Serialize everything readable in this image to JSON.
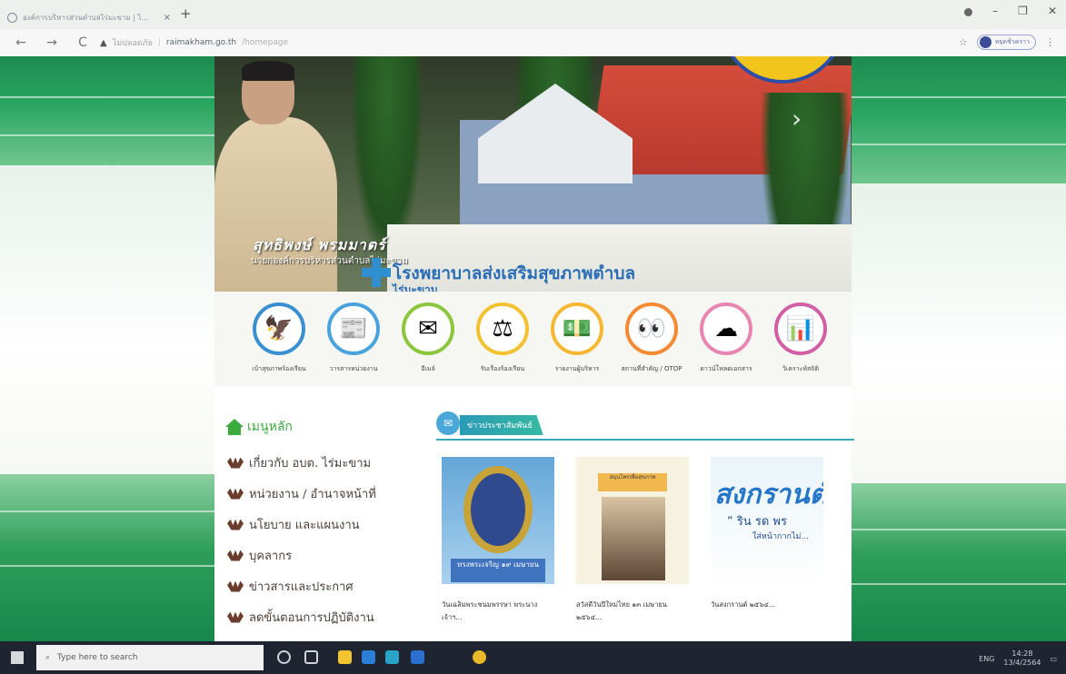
{
  "browser": {
    "tab_title": "องค์การบริหารส่วนตำบลไร่มะขาม | ไ...",
    "tab_close": "×",
    "new_tab": "+",
    "back": "←",
    "forward": "→",
    "reload": "C",
    "security": "ไม่ปลอดภัย",
    "url_host": "raimakham.go.th",
    "url_path": "/homepage",
    "profile_label": "หยุดชั่วคราว",
    "minimize": "–",
    "restore": "❐",
    "close": "✕"
  },
  "hero": {
    "person_name": "สุทธิพงษ์ พรมมาตร์",
    "person_position": "นายกองค์การบริหารส่วนตำบลไร่มะขาม",
    "sign_line1": "โรงพยาบาลส่งเสริมสุขภาพตำบล",
    "sign_line2": "ไร่มะขาม",
    "next_arrow": "›"
  },
  "quick_links": [
    {
      "label": "เบ้าสุขภาพร้องเรียน",
      "icon": "garuda-icon",
      "color": "#3a8fd0",
      "glyph": "🦅"
    },
    {
      "label": "วารสารหน่วยงาน",
      "icon": "journal-icon",
      "color": "#4aa3dc",
      "glyph": "📰"
    },
    {
      "label": "อีเมล์",
      "icon": "mail-icon",
      "color": "#8cc63f",
      "glyph": "✉"
    },
    {
      "label": "รับเรื่องร้องเรียน",
      "icon": "scales-icon",
      "color": "#f2c230",
      "glyph": "⚖"
    },
    {
      "label": "รายงานผู้บริหาร",
      "icon": "money-icon",
      "color": "#f7b733",
      "glyph": "💵"
    },
    {
      "label": "สถานที่สำคัญ / OTOP",
      "icon": "binoculars-icon",
      "color": "#f58a34",
      "glyph": "👀"
    },
    {
      "label": "ดาวน์โหลดเอกสาร",
      "icon": "download-icon",
      "color": "#e886b2",
      "glyph": "☁"
    },
    {
      "label": "วิเคราะห์สถิติ",
      "icon": "chart-icon",
      "color": "#d25fa4",
      "glyph": "📊"
    }
  ],
  "menu": {
    "heading": "เมนูหลัก",
    "items": [
      "เกี่ยวกับ อบต. ไร่มะขาม",
      "หน่วยงาน / อำนาจหน้าที่",
      "นโยบาย และแผนงาน",
      "บุคลากร",
      "ข่าวสารและประกาศ",
      "ลดขั้นตอนการปฏิบัติงาน"
    ]
  },
  "news": {
    "heading": "ข่าวประชาสัมพันธ์",
    "cards": [
      {
        "caption": "วันเฉลิมพระชนมพรรษา พระนางเจ้าฯ...",
        "overlay": "ทรงพระเจริญ ๑๙ เมษายน"
      },
      {
        "caption": "สวัสดีวันปีใหม่ไทย ๑๓ เมษายน ๒๕๖๔...",
        "overlay": "สมุนไพรเพื่อสุขภาพ"
      },
      {
        "caption": "วันสงกรานต์ ๒๕๖๔...",
        "overlay": "สงกรานต์",
        "overlay2": "“ ริน รด พร",
        "overlay3": "ใส่หน้ากากไม่..."
      }
    ]
  },
  "taskbar": {
    "search_placeholder": "Type here to search",
    "clock_time": "14:28",
    "clock_date": "13/4/2564",
    "lang": "ENG"
  }
}
